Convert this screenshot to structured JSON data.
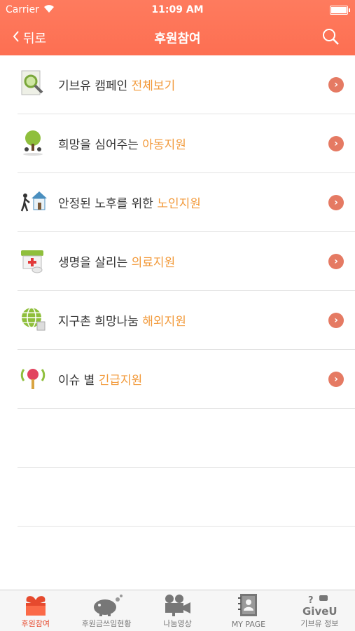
{
  "status_bar": {
    "carrier": "Carrier",
    "time": "11:09 AM"
  },
  "nav": {
    "back_label": "뒤로",
    "title": "후원참여"
  },
  "items": [
    {
      "prefix": "기브유 캠페인 ",
      "highlight": "전체보기",
      "icon": "magnifier-document-icon"
    },
    {
      "prefix": "희망을 심어주는 ",
      "highlight": "아동지원",
      "icon": "tree-children-icon"
    },
    {
      "prefix": "안정된 노후를 위한 ",
      "highlight": "노인지원",
      "icon": "elder-house-icon"
    },
    {
      "prefix": "생명을 살리는 ",
      "highlight": "의료지원",
      "icon": "medical-kit-icon"
    },
    {
      "prefix": "지구촌 희망나눔 ",
      "highlight": "해외지원",
      "icon": "globe-icon"
    },
    {
      "prefix": "이슈 별 ",
      "highlight": "긴급지원",
      "icon": "alert-pin-icon"
    }
  ],
  "tabs": [
    {
      "label": "후원참여",
      "icon": "heart-box-icon",
      "active": true
    },
    {
      "label": "후원금쓰임현황",
      "icon": "piggy-bank-icon",
      "active": false
    },
    {
      "label": "나눔영상",
      "icon": "video-camera-icon",
      "active": false
    },
    {
      "label": "MY PAGE",
      "icon": "address-book-icon",
      "active": false
    },
    {
      "label": "기브유 정보",
      "icon": "giveu-info-icon",
      "active": false
    }
  ],
  "tab_icon_text": "GiveU",
  "colors": {
    "header": "#fd6f52",
    "highlight": "#f29a3b",
    "chevron": "#e57a63",
    "active_tab": "#e64a2e"
  }
}
